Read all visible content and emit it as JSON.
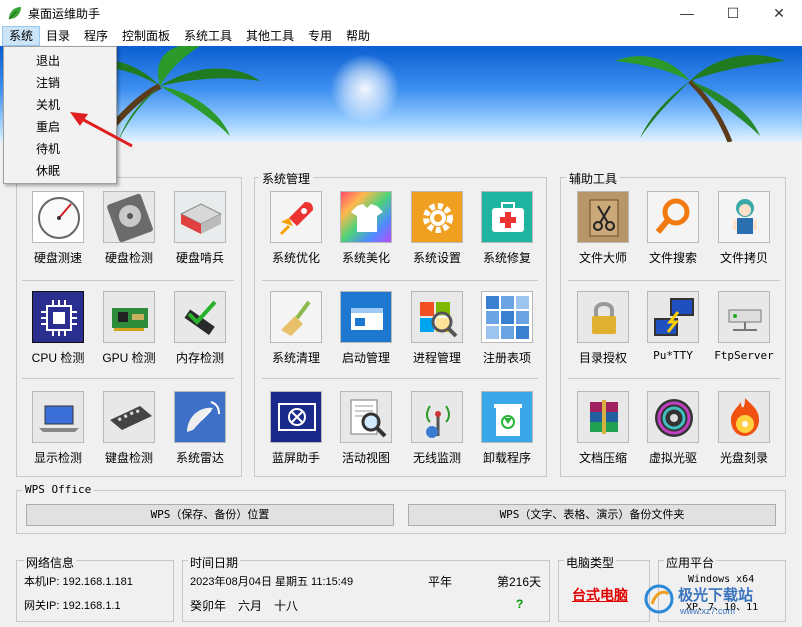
{
  "window": {
    "title": "桌面运维助手",
    "minimize": "—",
    "maximize": "☐",
    "close": "✕"
  },
  "menubar": [
    "系统",
    "目录",
    "程序",
    "控制面板",
    "系统工具",
    "其他工具",
    "专用",
    "帮助"
  ],
  "system_menu": [
    "退出",
    "注销",
    "关机",
    "重启",
    "待机",
    "休眠"
  ],
  "groups": {
    "system_mgmt": "系统管理",
    "aux_tools": "辅助工具",
    "wps": "WPS Office"
  },
  "hardware_tools": [
    "硬盘测速",
    "硬盘检测",
    "硬盘啃兵",
    "CPU 检测",
    "GPU 检测",
    "内存检测",
    "显示检测",
    "键盘检测",
    "系统雷达"
  ],
  "system_tools": [
    "系统优化",
    "系统美化",
    "系统设置",
    "系统修复",
    "系统清理",
    "启动管理",
    "进程管理",
    "注册表项",
    "蓝屏助手",
    "活动视图",
    "无线监测",
    "卸载程序"
  ],
  "aux_tools": [
    "文件大师",
    "文件搜索",
    "文件拷贝",
    "目录授权",
    "Pu*TTY",
    "FtpServer",
    "文档压缩",
    "虚拟光驱",
    "光盘刻录"
  ],
  "wps": {
    "backup_location": "WPS（保存、备份）位置",
    "backup_folder": "WPS（文字、表格、演示）备份文件夹"
  },
  "status": {
    "network_title": "网络信息",
    "local_ip": "本机IP: 192.168.1.181",
    "gateway_ip": "网关IP: 192.168.1.1",
    "datetime_title": "时间日期",
    "datetime": "2023年08月04日 星期五 11:15:49",
    "year_type": "平年",
    "day_of_year": "第216天",
    "lunar_year": "癸卯年",
    "lunar_month": "六月",
    "lunar_day": "十八",
    "question": "?",
    "pc_type_title": "电脑类型",
    "pc_type": "台式电脑",
    "platform_title": "应用平台",
    "platform": "Windows x64",
    "platform_versions": "XP、7、10、11"
  },
  "watermark": {
    "brand": "极光下载站",
    "site": "www.xz7.com"
  },
  "colors": {
    "accent_red": "#e00000",
    "question_green": "#009900",
    "arrow_red": "#e02020"
  }
}
